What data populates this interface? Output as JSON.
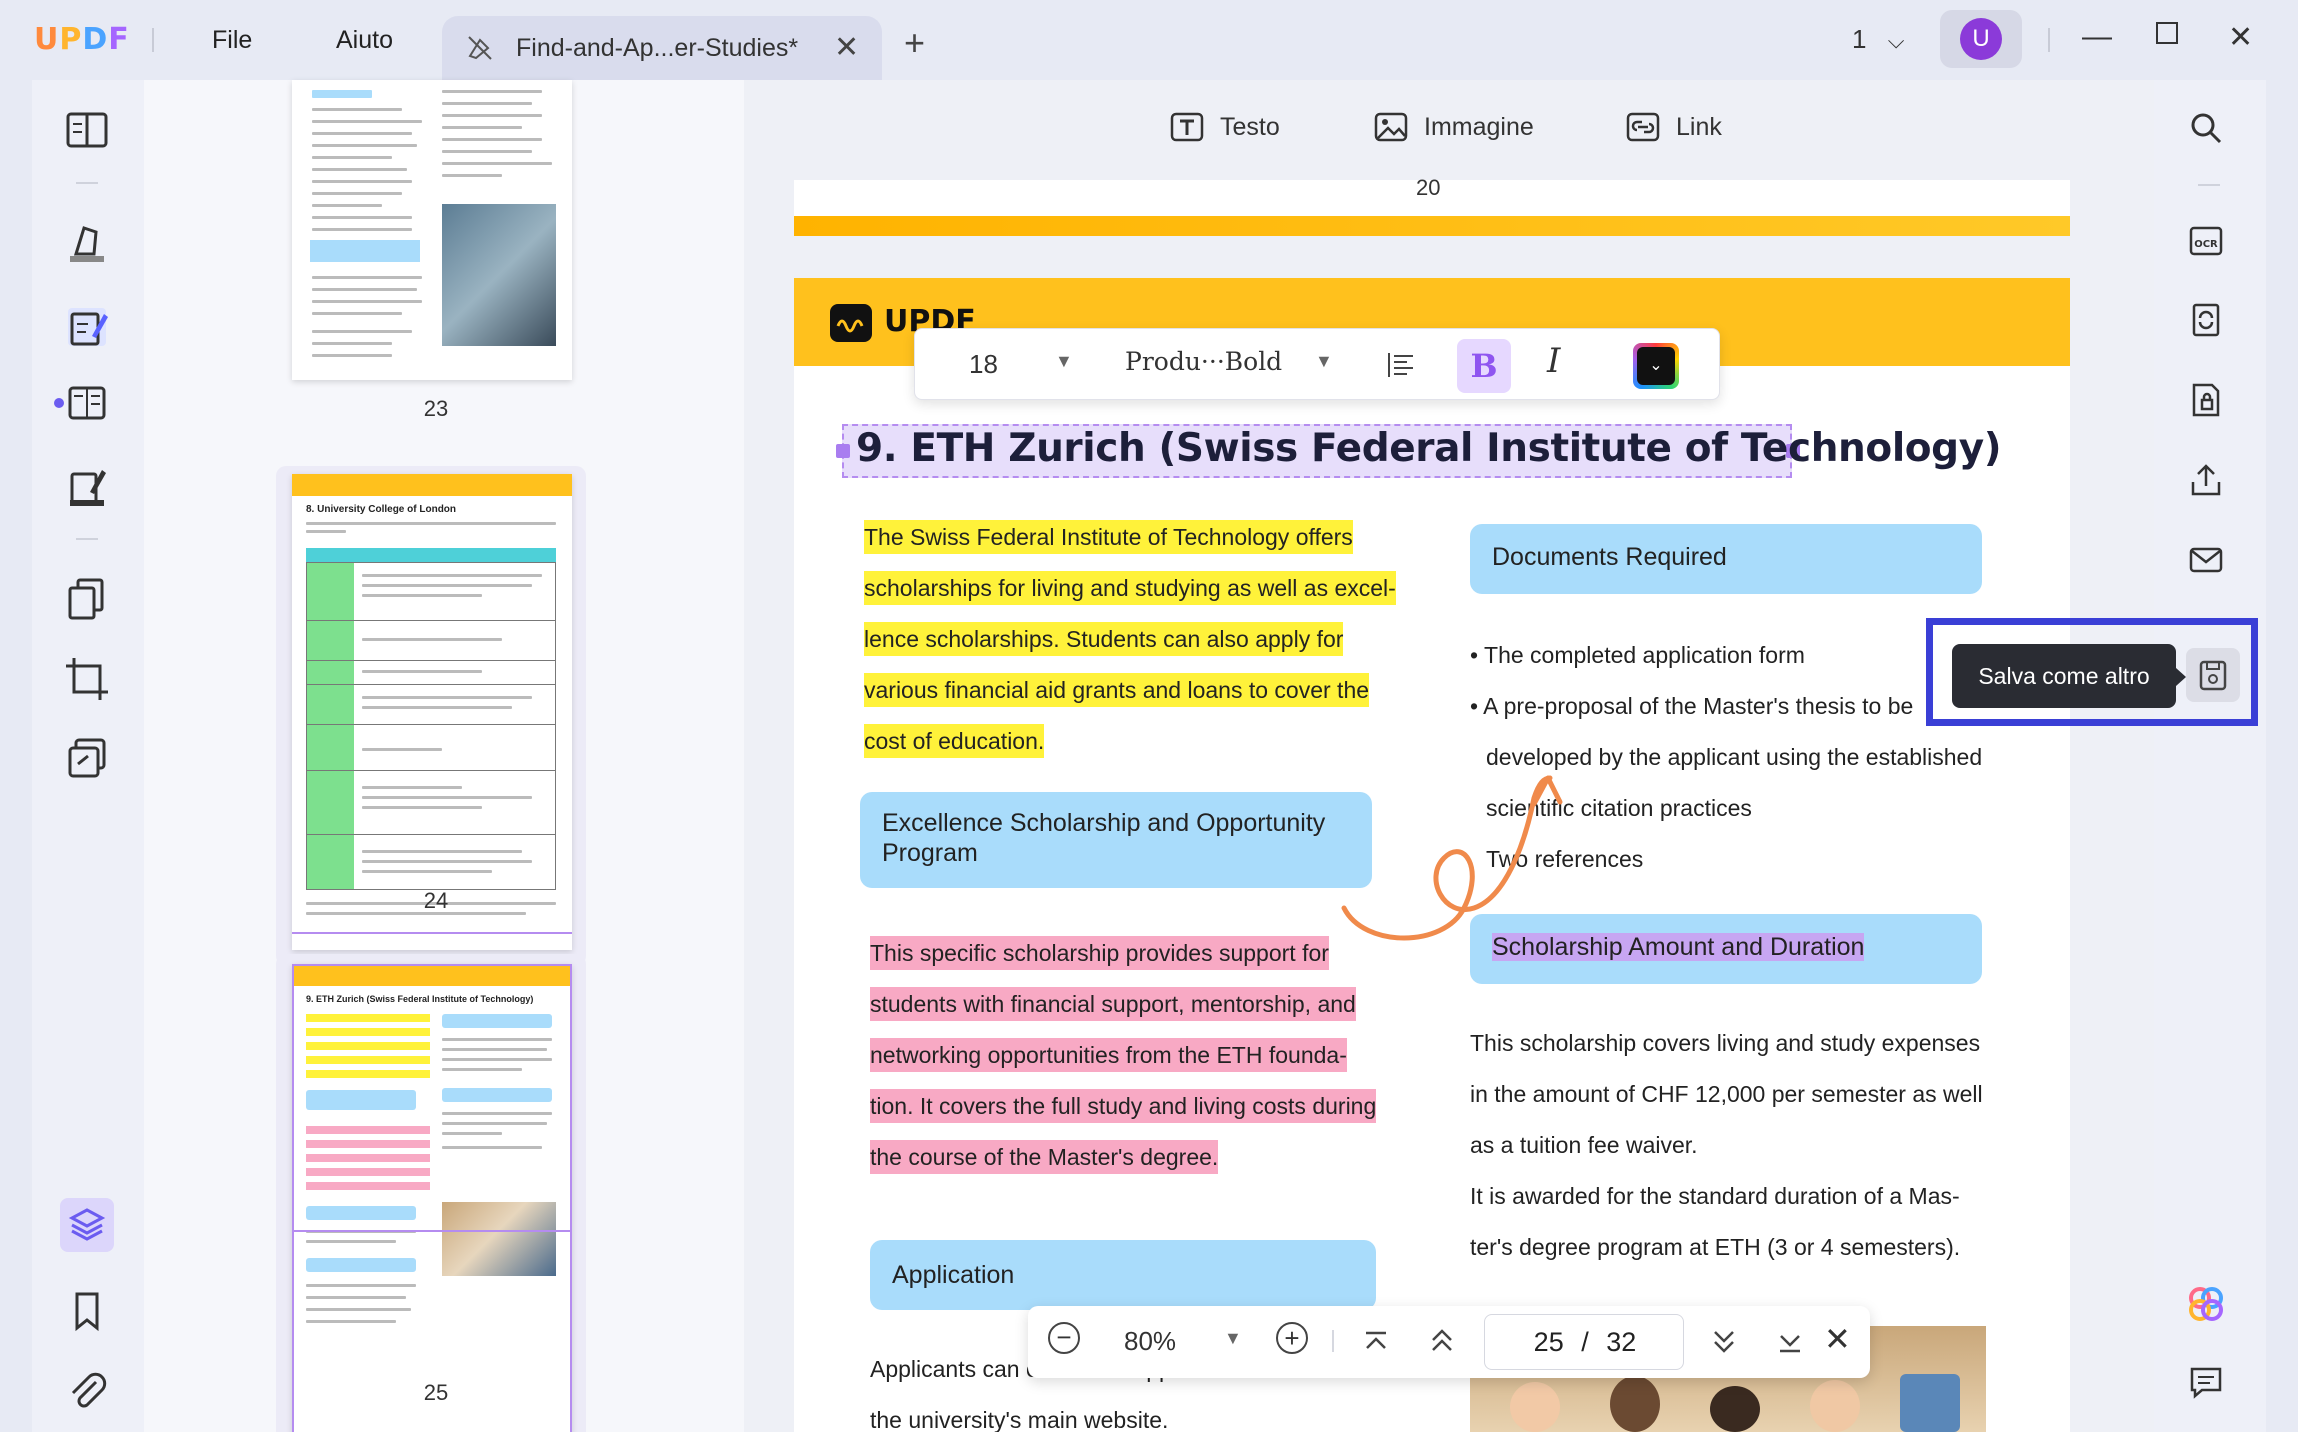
{
  "app": {
    "logo": "UPDF",
    "menu": [
      "File",
      "Aiuto"
    ],
    "tab_title": "Find-and-Ap...er-Studies*",
    "page_indicator": "1",
    "avatar_letter": "U"
  },
  "edit_toolbar": {
    "text": "Testo",
    "image": "Immagine",
    "link": "Link"
  },
  "thumbnails": [
    {
      "label": "23"
    },
    {
      "label": "24"
    },
    {
      "label": "25"
    }
  ],
  "thumb_texts": {
    "t24_title": "8. University College of London",
    "t25_title": "9. ETH Zurich (Swiss Federal Institute of Technology)"
  },
  "previous_page_number": "20",
  "format_bar": {
    "font_size": "18",
    "font_name": "Produ···Bold",
    "bold": "B",
    "italic": "I"
  },
  "document": {
    "page_logo": "UPDF",
    "heading": "9. ETH Zurich (Swiss Federal Institute of Technology)",
    "intro_lines": [
      "The Swiss Federal Institute of Technology offers",
      "scholarships for living and studying as well as excel-",
      "lence scholarships. Students can also apply for",
      "various financial aid grants and loans to cover the",
      "cost of education."
    ],
    "excellence_box": "Excellence Scholarship and Opportunity Program",
    "excellence_lines": [
      "This specific scholarship provides support for",
      "students with financial support, mentorship, and",
      "networking opportunities from the ETH founda-",
      "tion. It covers the full study and living costs during",
      "the course of the Master's degree."
    ],
    "application_box": "Application",
    "application_lines": [
      "Applicants can obtain the application form from",
      "the university's main website."
    ],
    "docs_box": "Documents Required",
    "docs_lines": [
      "• The completed application form",
      "• A pre-proposal of the Master's thesis to be",
      "developed by the applicant using the established",
      "scientific citation practices",
      "Two references"
    ],
    "amount_box": "Scholarship Amount and Duration",
    "amount_lines": [
      "This scholarship covers living and study expenses",
      "in the amount of CHF 12,000 per semester as well",
      "as a tuition fee waiver.",
      "It is awarded for the standard duration of a Mas-",
      "ter's degree program at ETH (3 or 4 semesters)."
    ]
  },
  "bottom_nav": {
    "zoom": "80%",
    "page_current": "25",
    "page_separator": "/",
    "page_total": "32"
  },
  "tooltip": {
    "text": "Salva come altro"
  },
  "colors": {
    "accent": "#6b5cf0",
    "highlight_yellow": "#fff23a",
    "highlight_pink": "#f8a9c4",
    "section_blue": "#a9dcfb",
    "brand_yellow": "#ffc11d",
    "tooltip_frame": "#3a3fd6"
  }
}
